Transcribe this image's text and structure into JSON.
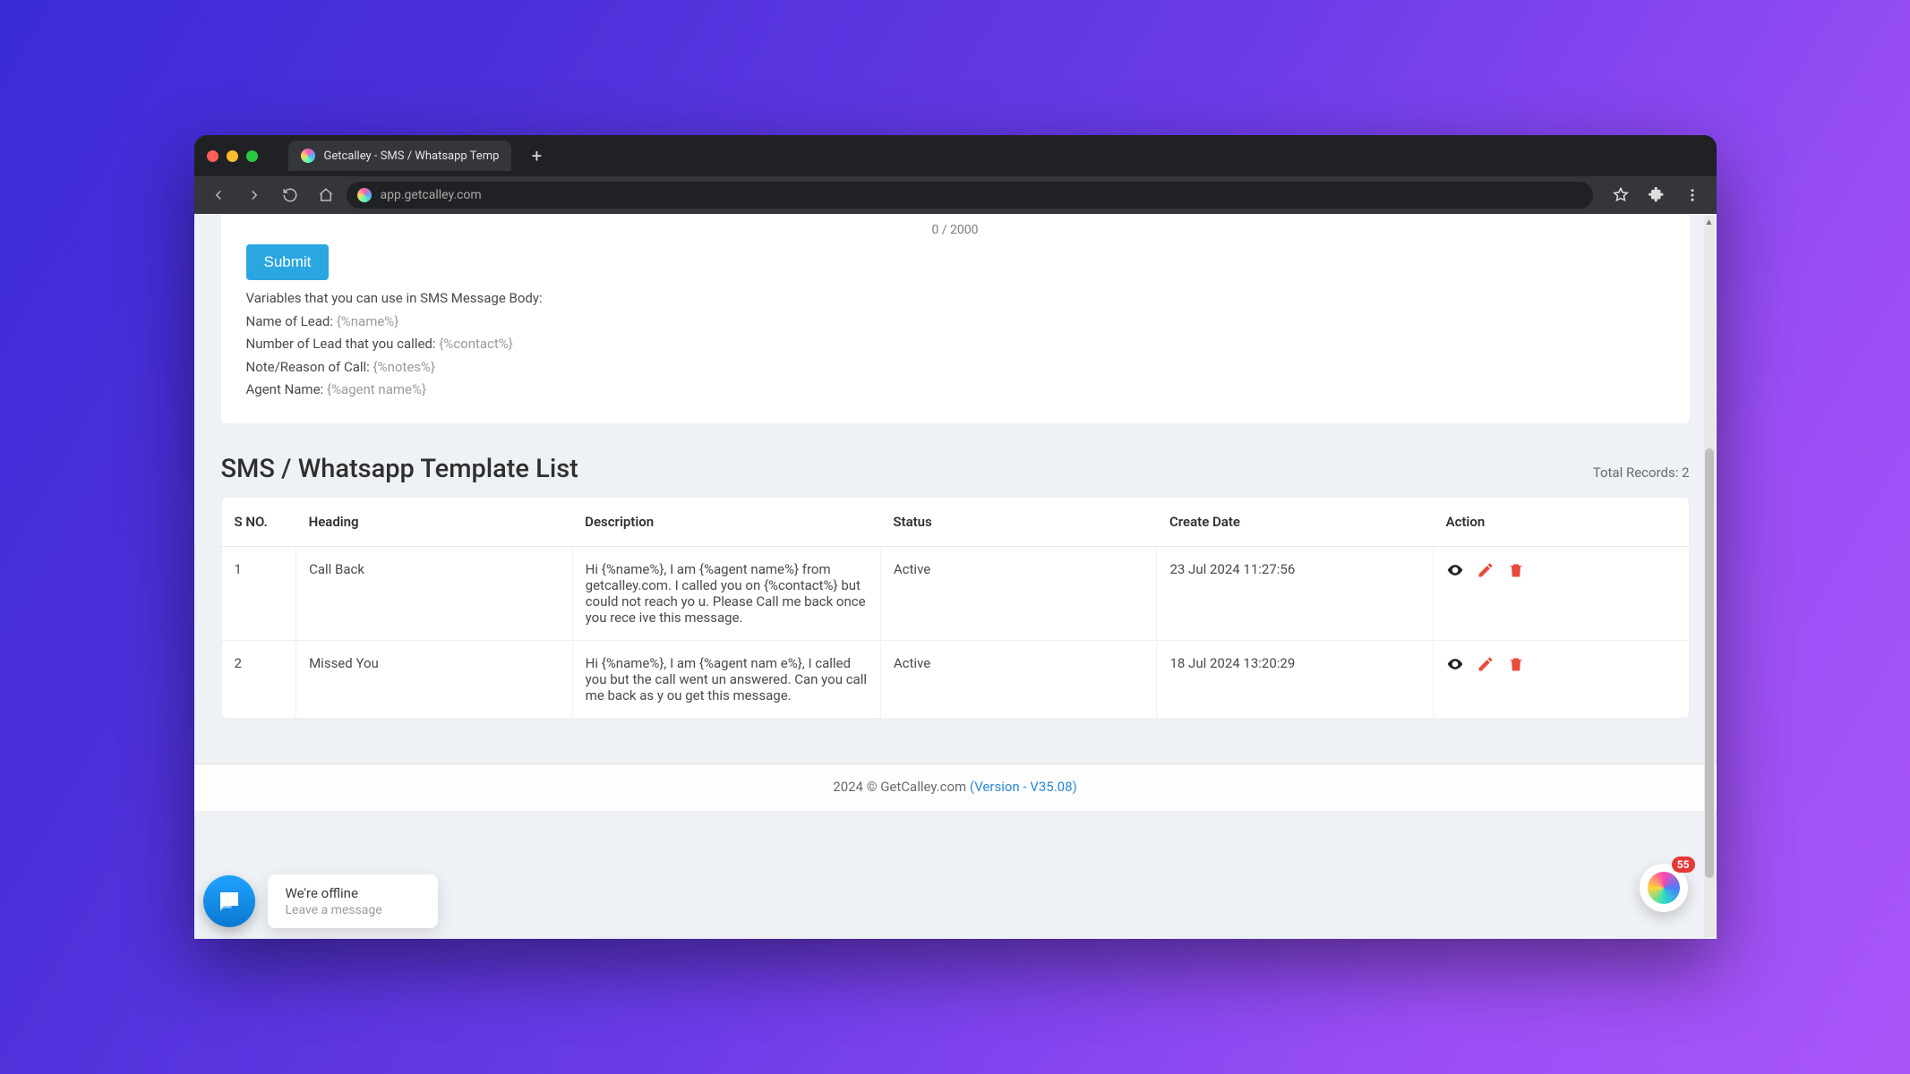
{
  "browser": {
    "tab_title": "Getcalley - SMS / Whatsapp Temp",
    "url": "app.getcalley.com"
  },
  "form": {
    "counter": "0 / 2000",
    "submit_label": "Submit",
    "vars_intro": "Variables that you can use in SMS Message Body:",
    "vars": [
      {
        "label": "Name of Lead: ",
        "placeholder": "{%name%}"
      },
      {
        "label": "Number of Lead that you called: ",
        "placeholder": "{%contact%}"
      },
      {
        "label": "Note/Reason of Call: ",
        "placeholder": "{%notes%}"
      },
      {
        "label": "Agent Name: ",
        "placeholder": "{%agent name%}"
      }
    ]
  },
  "list": {
    "title": "SMS / Whatsapp Template List",
    "total_records_label": "Total Records: 2"
  },
  "table": {
    "headers": {
      "sno": "S NO.",
      "heading": "Heading",
      "description": "Description",
      "status": "Status",
      "create_date": "Create Date",
      "action": "Action"
    },
    "rows": [
      {
        "sno": "1",
        "heading": "Call Back",
        "description": "Hi {%name%}, I am {%agent name%} from getcalley.com. I called you on {%contact%} but could not reach yo u. Please Call me back once you rece ive this message.",
        "status": "Active",
        "create_date": "23 Jul 2024 11:27:56"
      },
      {
        "sno": "2",
        "heading": "Missed You",
        "description": "Hi {%name%}, I am {%agent nam e%}, I called you but the call went un answered. Can you call me back as y ou get this message.",
        "status": "Active",
        "create_date": "18 Jul 2024 13:20:29"
      }
    ]
  },
  "footer": {
    "copyright": "2024 © GetCalley.com ",
    "version": "(Version - V35.08)"
  },
  "chat": {
    "line1": "We're offline",
    "line2": "Leave a message"
  },
  "help": {
    "badge": "55"
  }
}
